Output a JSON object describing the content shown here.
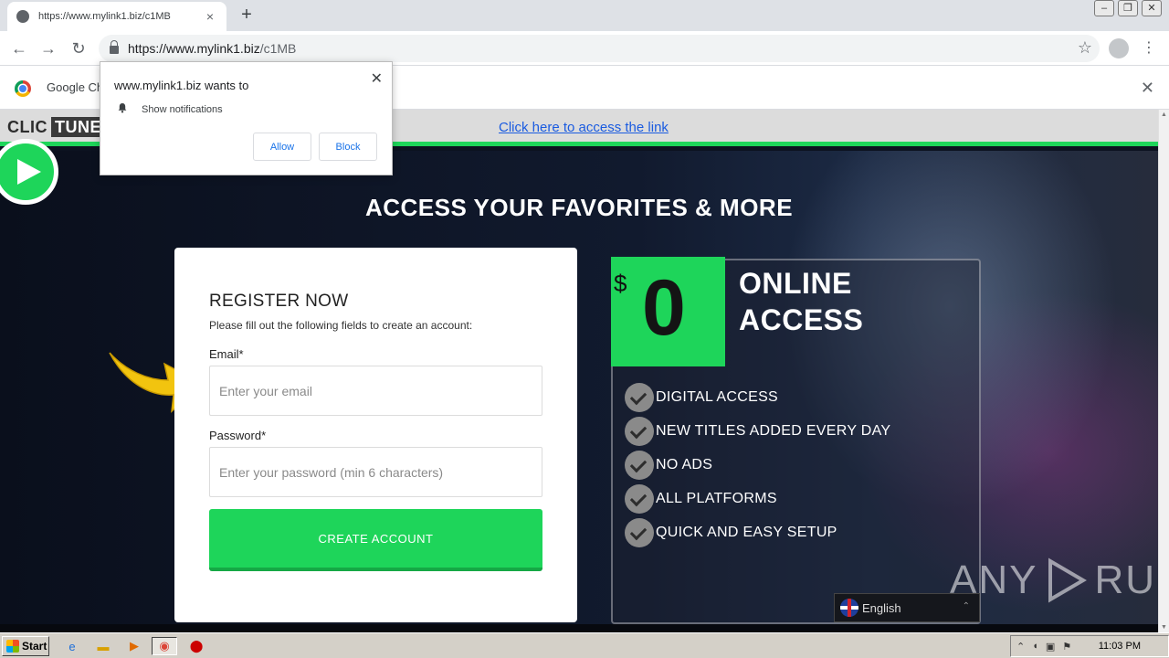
{
  "browser": {
    "tab_title": "https://www.mylink1.biz/c1MB",
    "tab_close": "×",
    "new_tab": "+",
    "url_host": "https://www.mylink1.biz",
    "url_path": "/c1MB",
    "window_controls": {
      "minimize": "‒",
      "restore": "❐",
      "close": "✕"
    },
    "back": "←",
    "forward": "→",
    "reload": "↻",
    "star": "☆",
    "menu": "⋮"
  },
  "infobar": {
    "text": "Google Ch",
    "close": "✕"
  },
  "popup": {
    "title": "www.mylink1.biz wants to",
    "close": "✕",
    "permission": "Show notifications",
    "allow": "Allow",
    "block": "Block"
  },
  "page": {
    "brand_left": "CLIC",
    "brand_right": "TUNE",
    "access_link": "Click here to access the link",
    "headline": "ACCESS YOUR FAVORITES & MORE",
    "register": {
      "title": "REGISTER NOW",
      "subtitle": "Please fill out the following fields to create an account:",
      "email_label": "Email*",
      "email_placeholder": "Enter your email",
      "password_label": "Password*",
      "password_placeholder": "Enter your password (min 6 characters)",
      "submit": "CREATE ACCOUNT"
    },
    "offer": {
      "currency": "$",
      "price": "0",
      "title_line1": "ONLINE",
      "title_line2": "ACCESS",
      "features": [
        "DIGITAL ACCESS",
        "NEW TITLES ADDED EVERY DAY",
        "NO ADS",
        "ALL PLATFORMS",
        "QUICK AND EASY SETUP"
      ]
    },
    "language": "English",
    "language_caret": "⌃"
  },
  "watermark": {
    "left": "ANY",
    "right": "RUN"
  },
  "taskbar": {
    "start": "Start",
    "clock": "11:03 PM"
  },
  "colors": {
    "accent_green": "#1ed55a",
    "link_blue": "#1a5be0",
    "arrow_yellow": "#f2c40f"
  }
}
